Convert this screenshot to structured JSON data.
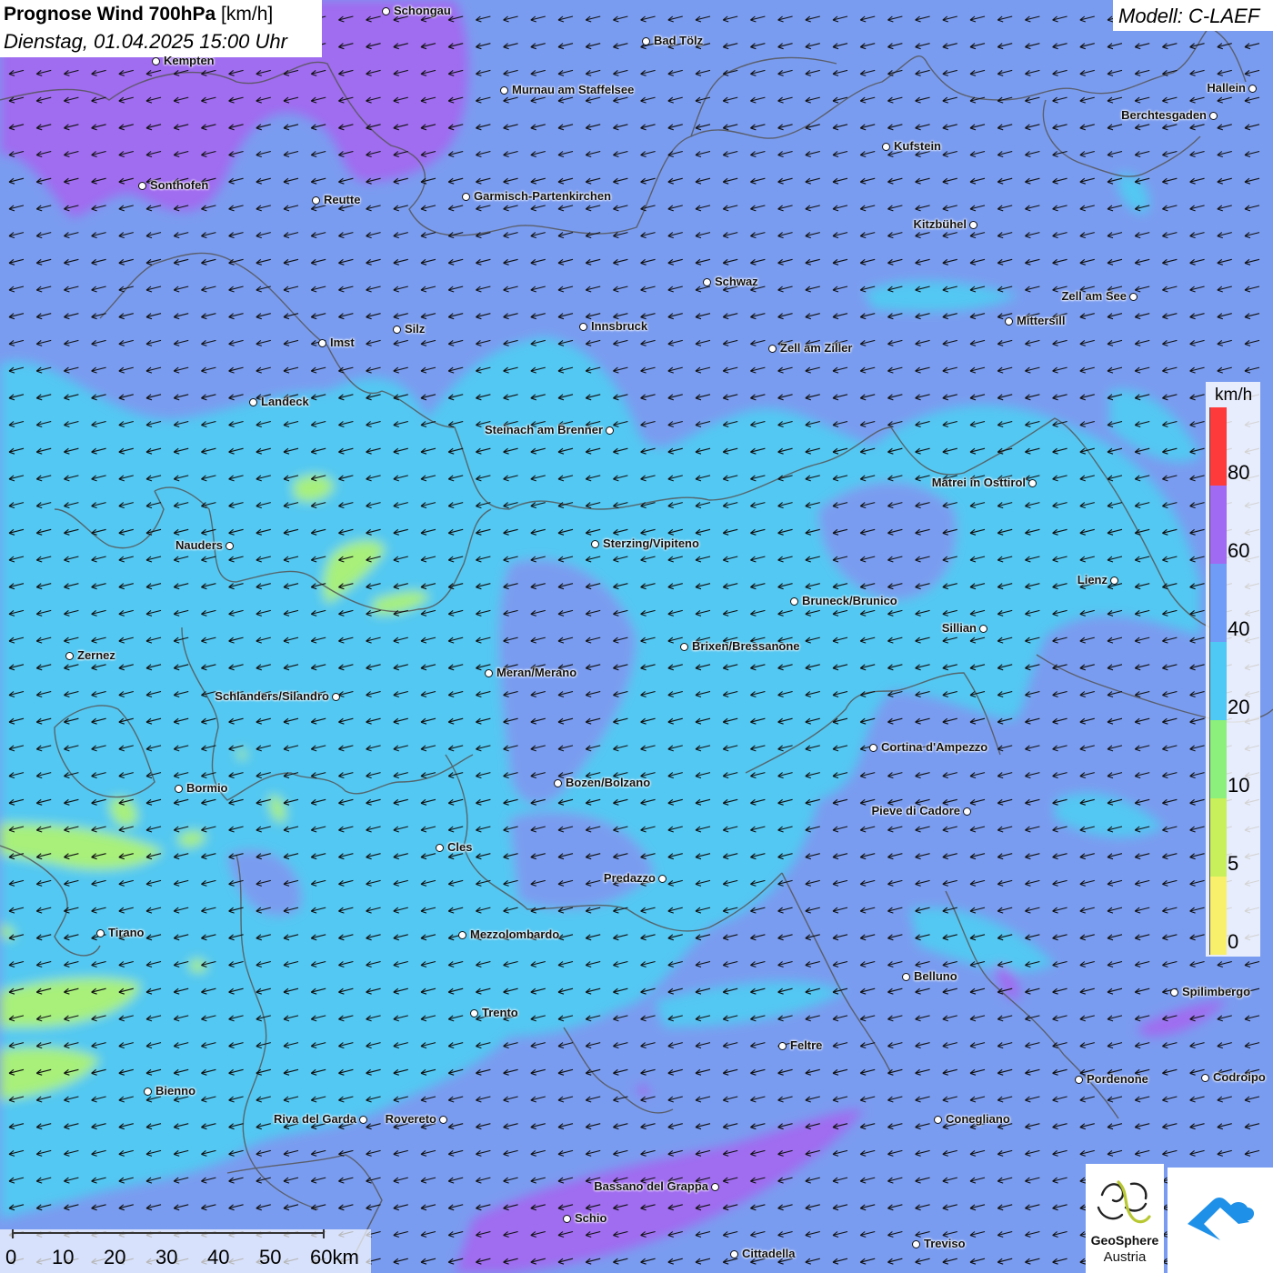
{
  "title": {
    "main": "Prognose Wind 700hPa",
    "unit": " [km/h]",
    "datetime": "Dienstag, 01.04.2025 15:00 Uhr"
  },
  "model_label": "Modell: C-LAEF",
  "wind_direction": "from east-northeast (arrows pointing west-southwest)",
  "colors": {
    "base_blue": "#7a9cf0",
    "cyan": "#52c8f2",
    "violet": "#a06cf0",
    "lime": "#a8f07a",
    "boundary": "#555555"
  },
  "cities": [
    {
      "name": "Schongau"
    },
    {
      "name": "Bad Tölz"
    },
    {
      "name": "Kempten"
    },
    {
      "name": "Murnau am Staffelsee"
    },
    {
      "name": "Hallein"
    },
    {
      "name": "Berchtesgaden"
    },
    {
      "name": "Kufstein"
    },
    {
      "name": "Sonthofen"
    },
    {
      "name": "Reutte"
    },
    {
      "name": "Garmisch-Partenkirchen"
    },
    {
      "name": "Kitzbühel"
    },
    {
      "name": "Schwaz"
    },
    {
      "name": "Zell am See"
    },
    {
      "name": "Mittersill"
    },
    {
      "name": "Innsbruck"
    },
    {
      "name": "Silz"
    },
    {
      "name": "Imst"
    },
    {
      "name": "Zell am Ziller"
    },
    {
      "name": "Landeck"
    },
    {
      "name": "Steinach am Brenner"
    },
    {
      "name": "Matrei in Osttirol"
    },
    {
      "name": "Nauders"
    },
    {
      "name": "Sterzing/Vipiteno"
    },
    {
      "name": "Lienz"
    },
    {
      "name": "Bruneck/Brunico"
    },
    {
      "name": "Sillian"
    },
    {
      "name": "Brixen/Bressanone"
    },
    {
      "name": "Zernez"
    },
    {
      "name": "Meran/Merano"
    },
    {
      "name": "Schlanders/Silandro"
    },
    {
      "name": "Cortina d'Ampezzo"
    },
    {
      "name": "Bozen/Bolzano"
    },
    {
      "name": "Bormio"
    },
    {
      "name": "Pieve di Cadore"
    },
    {
      "name": "Cles"
    },
    {
      "name": "Predazzo"
    },
    {
      "name": "Tirano"
    },
    {
      "name": "Mezzolombardo"
    },
    {
      "name": "Belluno"
    },
    {
      "name": "Spilimbergo"
    },
    {
      "name": "Trento"
    },
    {
      "name": "Feltre"
    },
    {
      "name": "Pordenone"
    },
    {
      "name": "Codroipo"
    },
    {
      "name": "Bienno"
    },
    {
      "name": "Riva del Garda"
    },
    {
      "name": "Rovereto"
    },
    {
      "name": "Conegliano"
    },
    {
      "name": "Bassano del Grappa"
    },
    {
      "name": "Schio"
    },
    {
      "name": "Treviso"
    },
    {
      "name": "Cittadella"
    }
  ],
  "legend": {
    "unit": "km/h",
    "classes": [
      {
        "label": "0",
        "color": "#f8f06a"
      },
      {
        "label": "5",
        "color": "#c8f05a"
      },
      {
        "label": "10",
        "color": "#8cf07c"
      },
      {
        "label": "20",
        "color": "#4ec8f4"
      },
      {
        "label": "40",
        "color": "#6e9cf6"
      },
      {
        "label": "60",
        "color": "#a06af2"
      },
      {
        "label": "80",
        "color": "#ff3a3a"
      }
    ]
  },
  "scalebar": {
    "ticks": [
      "0",
      "10",
      "20",
      "30",
      "40",
      "50",
      "60km"
    ]
  },
  "logos": {
    "name": "GeoSphere",
    "sub": "Austria"
  }
}
